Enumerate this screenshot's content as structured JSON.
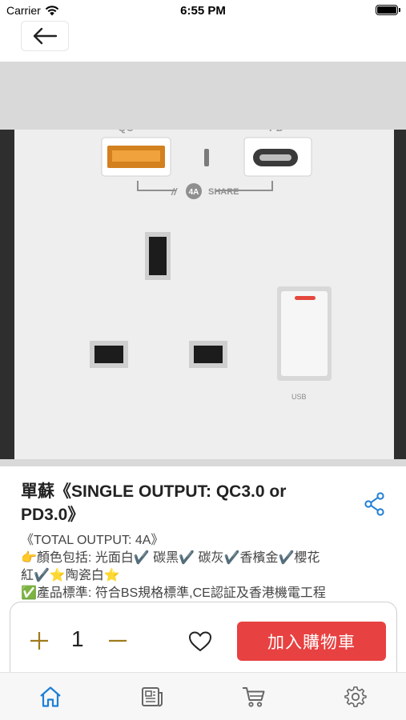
{
  "status_bar": {
    "carrier": "Carrier",
    "time": "6:55 PM"
  },
  "header": {
    "back_icon": "arrow-left-icon"
  },
  "product": {
    "title": "單蘇《SINGLE OUTPUT: QC3.0 or PD3.0》",
    "image_labels": {
      "left_port": "QC",
      "right_port": "PD",
      "share_badge": "4A",
      "share_text": "SHARE",
      "usb_mark": "USB"
    },
    "description_lines": [
      "《TOTAL OUTPUT: 4A》",
      "👉顏色包括: 光面白✔️ 碳黑✔️ 碳灰✔️香檳金✔️櫻花",
      "紅✔️⭐陶瓷白⭐",
      "✅產品標準: 符合BS規格標準,CE認証及香港機電工程"
    ]
  },
  "cart": {
    "quantity": "1",
    "add_to_cart_label": "加入購物車",
    "colors": {
      "button": "#e84141",
      "qty_controls": "#a07a1c"
    }
  },
  "tabs": [
    {
      "icon": "home-icon",
      "active": true
    },
    {
      "icon": "news-icon",
      "active": false
    },
    {
      "icon": "cart-icon",
      "active": false
    },
    {
      "icon": "gear-icon",
      "active": false
    }
  ],
  "colors": {
    "accent": "#1e7fd6",
    "tab_inactive": "#666666"
  }
}
